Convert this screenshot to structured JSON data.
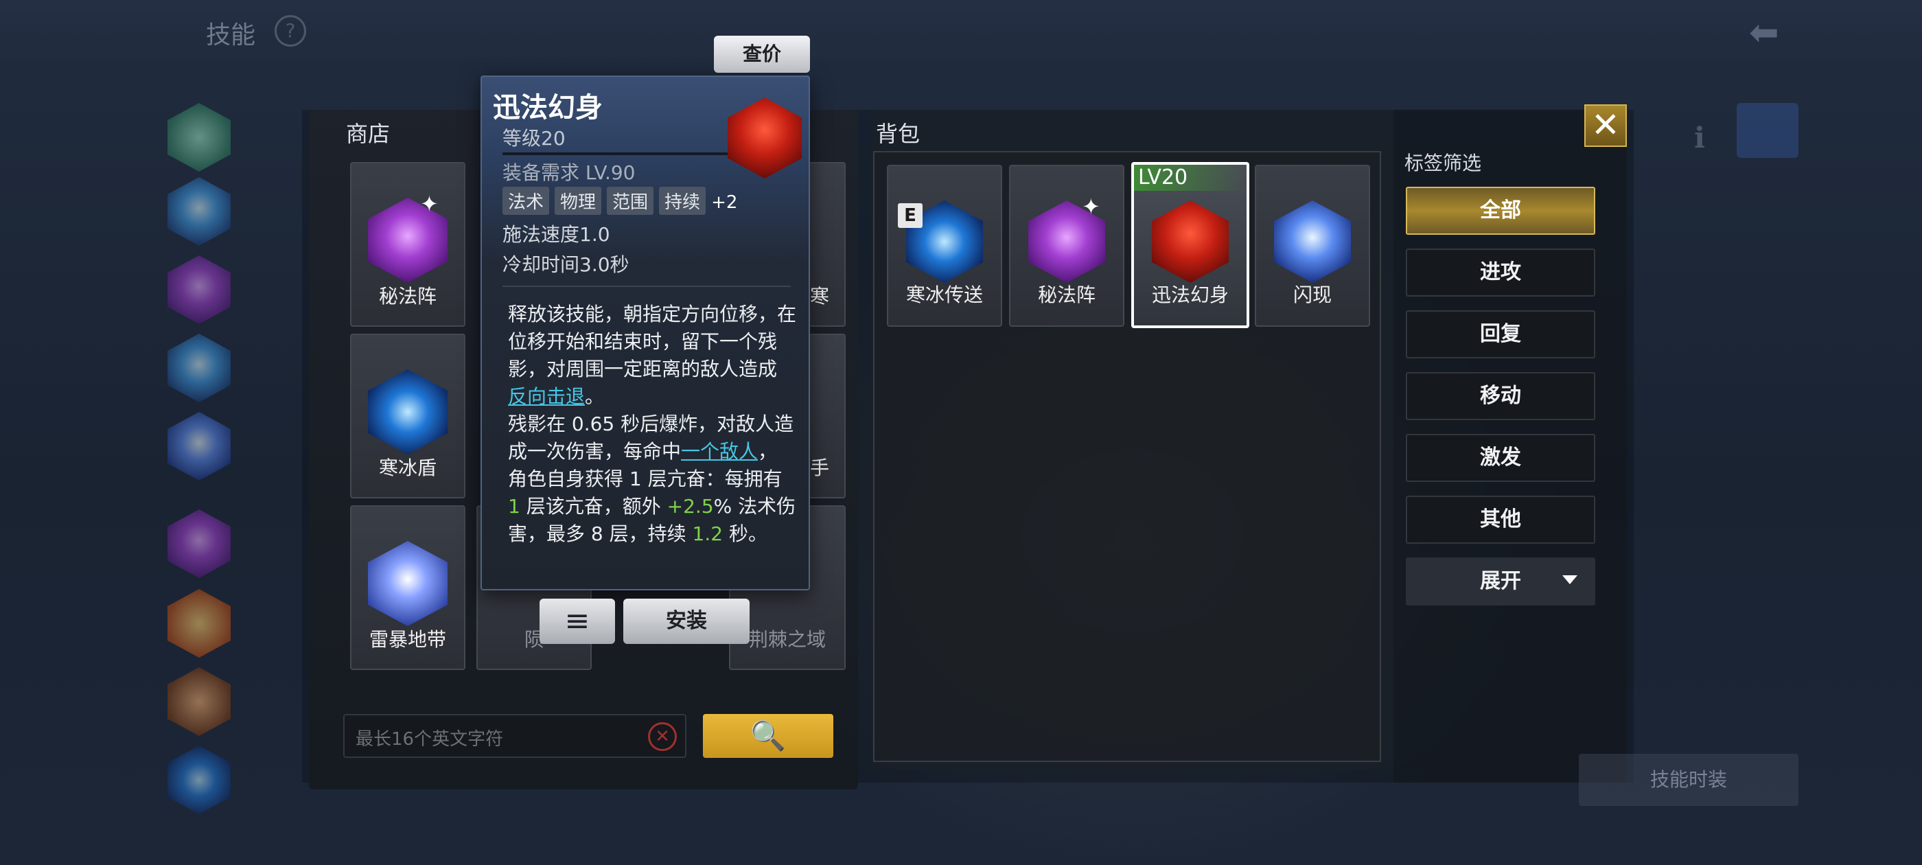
{
  "top": {
    "title": "技能",
    "help": "?",
    "back": "⬅"
  },
  "shop": {
    "title": "商店",
    "cards": [
      {
        "name": "秘法阵",
        "icon": "arcane-array-icon",
        "starred": true
      },
      {
        "name": "寒",
        "icon": "hidden-card-icon",
        "starred": false
      },
      {
        "name": "寒冰盾",
        "icon": "ice-shield-icon",
        "starred": false
      },
      {
        "name": "手",
        "icon": "hidden-card-icon",
        "starred": false
      },
      {
        "name": "雷暴地带",
        "icon": "thunderstorm-zone-icon",
        "starred": false
      },
      {
        "name": "陨",
        "icon": "meteor-icon",
        "starred": false
      },
      {
        "name": "荆棘之域",
        "icon": "thorn-domain-icon",
        "starred": false
      }
    ],
    "search_placeholder": "最长16个英文字符",
    "search_clear": "✕",
    "search_icon": "🔍"
  },
  "tooltip": {
    "price_button": "查价",
    "name": "迅法幻身",
    "level": "等级20",
    "requirement": "装备需求 LV.90",
    "tags": [
      "法术",
      "物理",
      "范围",
      "持续"
    ],
    "tags_more": "+2",
    "cast_speed": "施法速度1.0",
    "cooldown": "冷却时间3.0秒",
    "desc": {
      "p1a": "释放该技能，朝指定方向位移，在位移开始和结束时，留下一个残影，对周围一定距离的敌人造成",
      "p1link": "反向击退",
      "p1b": "。",
      "p2a": "残影在 0.65 秒后爆炸，对敌人造成一次伤害，每命中",
      "p2link": "一个敌人",
      "p2b": "，角色自身获得 1 层亢奋：每拥有 ",
      "p2num1": "1",
      "p2c": " 层该亢奋，额外 ",
      "p2num2": "+2.5",
      "p2d": "% 法术伤害，最多 8 层，持续 ",
      "p2num3": "1.2",
      "p2e": " 秒。"
    },
    "menu_button": "≡",
    "install_button": "安装"
  },
  "bag": {
    "title": "背包",
    "cards": [
      {
        "name": "寒冰传送",
        "badge": "E",
        "icon": "ice-teleport-icon"
      },
      {
        "name": "秘法阵",
        "icon": "arcane-array-icon",
        "starred": true
      },
      {
        "name": "迅法幻身",
        "level": "LV20",
        "icon": "swift-phantom-icon",
        "selected": true
      },
      {
        "name": "闪现",
        "icon": "flash-icon"
      }
    ]
  },
  "filter": {
    "title": "标签筛选",
    "options": [
      "全部",
      "进攻",
      "回复",
      "移动",
      "激发",
      "其他"
    ],
    "active": "全部",
    "expand": "展开"
  },
  "close": "✕",
  "skill_time": "技能时装",
  "colors": {
    "accent_gold": "#d8b85a",
    "link": "#46c7e6",
    "highlight_num": "#7fd34a",
    "level_badge": "#3f8a36"
  }
}
